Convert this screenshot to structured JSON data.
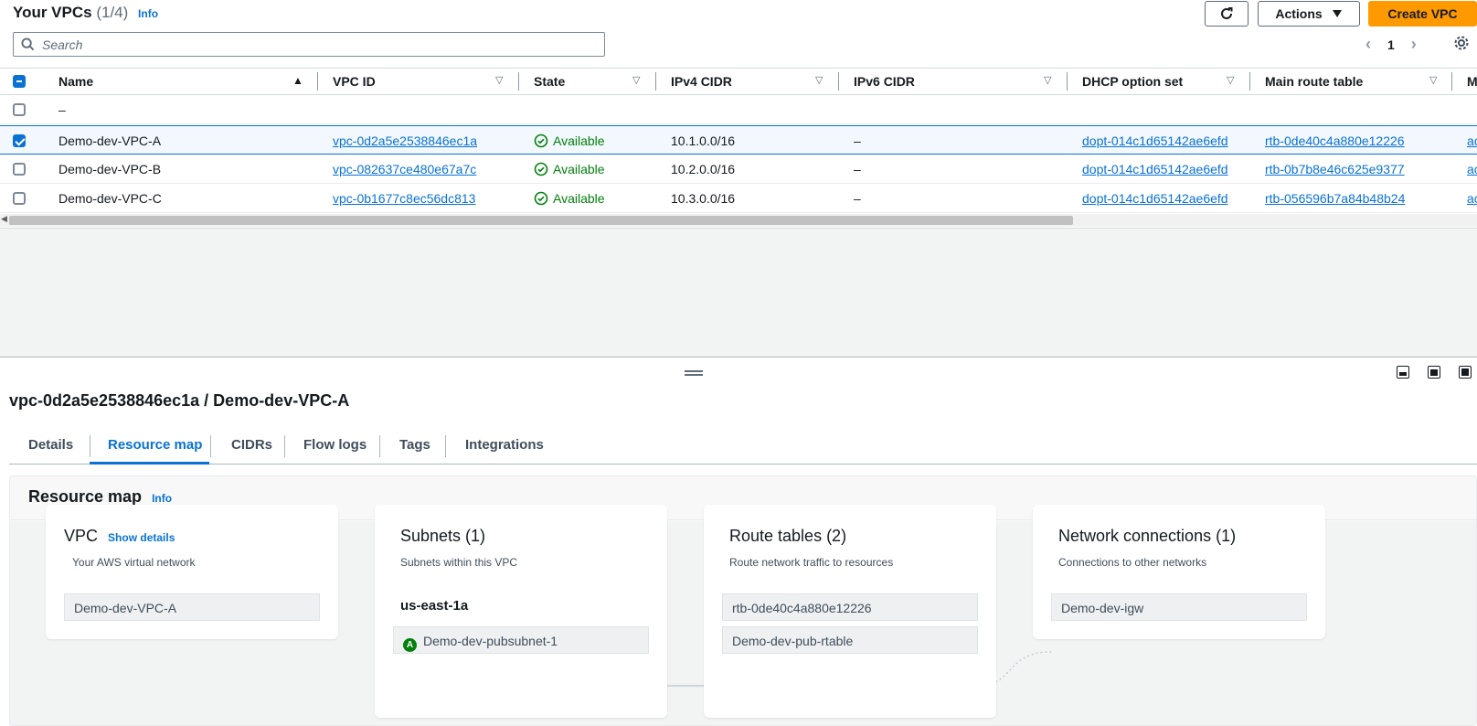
{
  "header": {
    "title": "Your VPCs",
    "count": "(1/4)",
    "info": "Info",
    "actions_label": "Actions",
    "create_label": "Create VPC"
  },
  "search": {
    "placeholder": "Search"
  },
  "pagination": {
    "page": "1"
  },
  "table": {
    "columns": [
      "Name",
      "VPC ID",
      "State",
      "IPv4 CIDR",
      "IPv6 CIDR",
      "DHCP option set",
      "Main route table",
      "M"
    ],
    "rows": [
      {
        "name": "–",
        "vpc_id": "",
        "state": "",
        "ipv4": "",
        "ipv6": "",
        "dhcp": "",
        "route_table": "",
        "more": "",
        "selected": false
      },
      {
        "name": "Demo-dev-VPC-A",
        "vpc_id": "vpc-0d2a5e2538846ec1a",
        "state": "Available",
        "ipv4": "10.1.0.0/16",
        "ipv6": "–",
        "dhcp": "dopt-014c1d65142ae6efd",
        "route_table": "rtb-0de40c4a880e12226",
        "more": "ac",
        "selected": true
      },
      {
        "name": "Demo-dev-VPC-B",
        "vpc_id": "vpc-082637ce480e67a7c",
        "state": "Available",
        "ipv4": "10.2.0.0/16",
        "ipv6": "–",
        "dhcp": "dopt-014c1d65142ae6efd",
        "route_table": "rtb-0b7b8e46c625e9377",
        "more": "ac",
        "selected": false
      },
      {
        "name": "Demo-dev-VPC-C",
        "vpc_id": "vpc-0b1677c8ec56dc813",
        "state": "Available",
        "ipv4": "10.3.0.0/16",
        "ipv6": "–",
        "dhcp": "dopt-014c1d65142ae6efd",
        "route_table": "rtb-056596b7a84b48b24",
        "more": "ac",
        "selected": false
      }
    ]
  },
  "detail": {
    "title": "vpc-0d2a5e2538846ec1a / Demo-dev-VPC-A",
    "tabs": [
      "Details",
      "Resource map",
      "CIDRs",
      "Flow logs",
      "Tags",
      "Integrations"
    ],
    "active_tab": "Resource map"
  },
  "resource_map": {
    "title": "Resource map",
    "info": "Info",
    "vpc": {
      "title": "VPC",
      "show_details": "Show details",
      "subtitle": "Your AWS virtual network",
      "item": "Demo-dev-VPC-A"
    },
    "subnets": {
      "title": "Subnets (1)",
      "subtitle": "Subnets within this VPC",
      "az": "us-east-1a",
      "badge": "A",
      "item": "Demo-dev-pubsubnet-1"
    },
    "route_tables": {
      "title": "Route tables (2)",
      "subtitle": "Route network traffic to resources",
      "items": [
        "rtb-0de40c4a880e12226",
        "Demo-dev-pub-rtable"
      ]
    },
    "network": {
      "title": "Network connections (1)",
      "subtitle": "Connections to other networks",
      "item": "Demo-dev-igw"
    }
  },
  "colors": {
    "accent": "#0972d3",
    "primary_button": "#ff9900",
    "success": "#037f0c"
  }
}
